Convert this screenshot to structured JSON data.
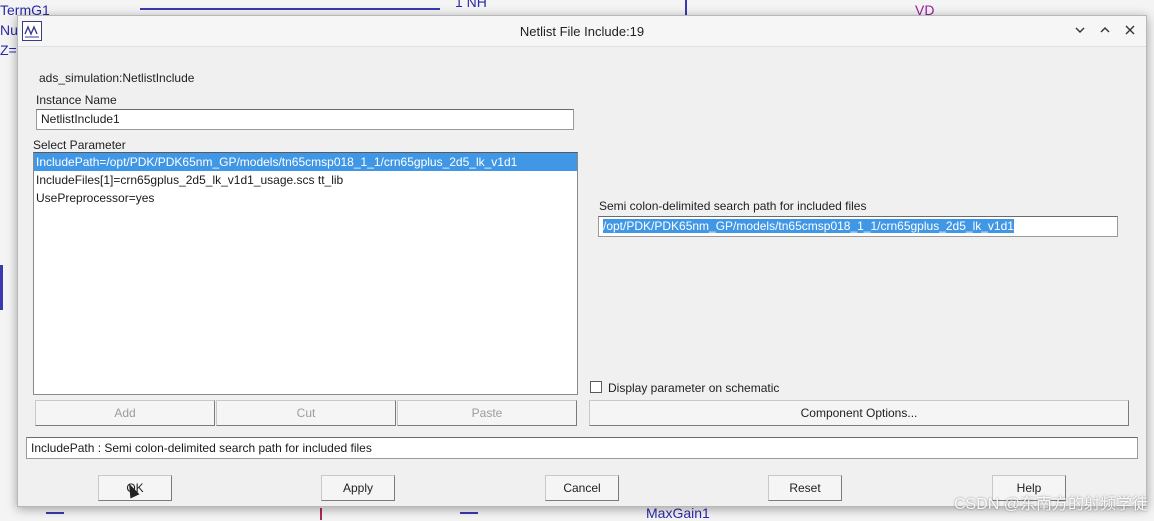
{
  "schematic": {
    "fragments": [
      "TermG1",
      "Nu",
      "Z=",
      "1 NH",
      "VD",
      "MaxGain1"
    ]
  },
  "window": {
    "title": "Netlist File Include:19",
    "controls": [
      "chevron-down-icon",
      "chevron-up-icon",
      "close-icon"
    ]
  },
  "component": {
    "type_label": "ads_simulation:NetlistInclude",
    "instance_name_label": "Instance Name",
    "instance_name_value": "NetlistInclude1"
  },
  "parameters": {
    "label": "Select Parameter",
    "items": [
      "IncludePath=/opt/PDK/PDK65nm_GP/models/tn65cmsp018_1_1/crn65gplus_2d5_lk_v1d1",
      "IncludeFiles[1]=crn65gplus_2d5_lk_v1d1_usage.scs tt_lib",
      "UsePreprocessor=yes"
    ],
    "selected_index": 0
  },
  "editor": {
    "label": "Semi colon-delimited search path for included files",
    "value": "/opt/PDK/PDK65nm_GP/models/tn65cmsp018_1_1/crn65gplus_2d5_lk_v1d1",
    "display_param_label": "Display parameter on schematic",
    "display_param_checked": false
  },
  "list_buttons": {
    "add": "Add",
    "cut": "Cut",
    "paste": "Paste"
  },
  "component_options_button": "Component Options...",
  "status_text": "IncludePath : Semi colon-delimited search path for included files",
  "footer_buttons": {
    "ok": "OK",
    "apply": "Apply",
    "cancel": "Cancel",
    "reset": "Reset",
    "help": "Help"
  },
  "watermark": "CSDN @东南方的射频学徒"
}
